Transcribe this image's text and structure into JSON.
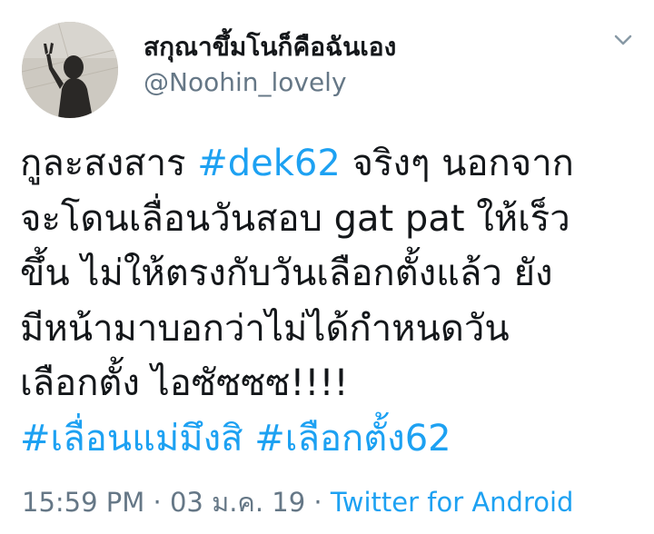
{
  "user": {
    "display_name": "สกุณาขึ้มโนก็คือฉันเอง",
    "handle": "@Noohin_lovely"
  },
  "tweet": {
    "line1": {
      "a": "กูละสงสาร ",
      "tag": "#dek62",
      "b": " จริงๆ นอกจาก"
    },
    "line2": "จะโดนเลื่อนวันสอบ gat pat ให้เร็ว",
    "line3": "ขึ้น ไม่ให้ตรงกับวันเลือกตั้งแล้ว ยัง",
    "line4": "มีหน้ามาบอกว่าไม่ได้กำหนดวัน",
    "line5": "เลือกตั้ง ไอซัซซซ!!!!",
    "line6": {
      "tag1": "#เลื่อนแม่มึงสิ",
      "sep": " ",
      "tag2": "#เลือกตั้ง62"
    }
  },
  "meta": {
    "time": "15:59 PM",
    "dot1": " · ",
    "date": "03 ม.ค. 19",
    "dot2": " · ",
    "source": "Twitter for Android"
  },
  "colors": {
    "link": "#1da1f2",
    "secondary": "#657786",
    "text": "#14171a"
  },
  "icons": {
    "menu": "chevron-down-icon"
  }
}
